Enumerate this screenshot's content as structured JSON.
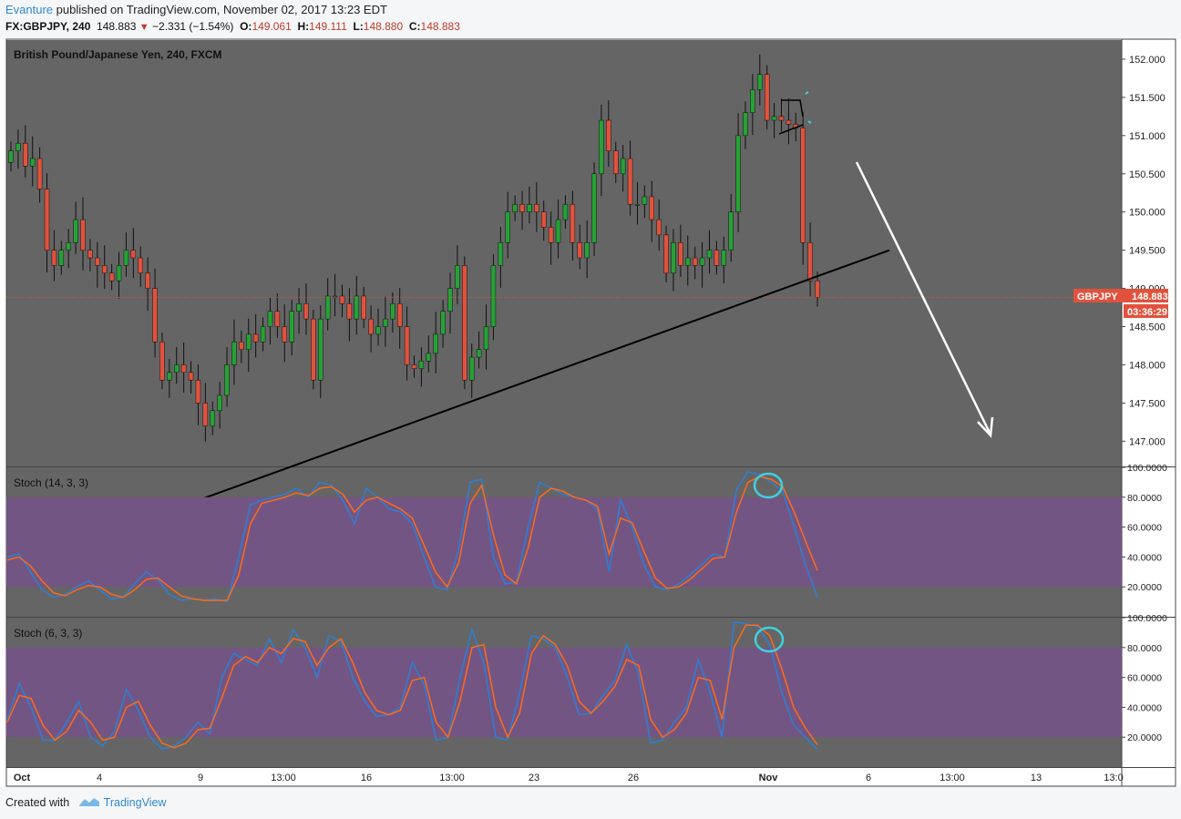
{
  "header": {
    "author": "Evanture",
    "published": "published on TradingView.com, November 02, 2017 13:23 EDT",
    "symbol": "FX:GBPJPY, 240",
    "last": "148.883",
    "change": "−2.331 (−1.54%)",
    "open_label": "O:",
    "open": "149.061",
    "high_label": "H:",
    "high": "149.111",
    "low_label": "L:",
    "low": "148.880",
    "close_label": "C:",
    "close": "148.883"
  },
  "price_pane": {
    "title": "British Pound/Japanese Yen, 240, FXCM",
    "badge_symbol": "GBPJPY",
    "badge_price": "148.883",
    "badge_countdown": "03:36:29"
  },
  "stoch1_title": "Stoch (14, 3, 3)",
  "stoch2_title": "Stoch (6, 3, 3)",
  "footer": {
    "created_with": "Created with",
    "brand": "TradingView"
  },
  "colors": {
    "pane_bg": "#656565",
    "stoch_band": "#735583",
    "up": "#26a136",
    "down": "#e1523d",
    "k_line": "#2d7fd6",
    "d_line": "#ff6a1a",
    "price_line": "#e1523d",
    "badge": "#e1523d",
    "axis_text": "#222222"
  },
  "chart_data": [
    {
      "type": "candlestick",
      "title": "British Pound/Japanese Yen, 240, FXCM",
      "x_ticks": [
        "Oct",
        "4",
        "9",
        "13:00",
        "16",
        "13:00",
        "23",
        "26",
        "Nov",
        "6",
        "13:00",
        "13",
        "13:0"
      ],
      "y_ticks": [
        "152.000",
        "151.500",
        "151.000",
        "150.500",
        "150.000",
        "149.500",
        "149.000",
        "148.500",
        "148.000",
        "147.500",
        "147.000"
      ],
      "ylim": [
        146.67,
        152.25
      ],
      "last_price": 148.883,
      "close_series": [
        150.8,
        150.9,
        150.6,
        150.7,
        150.3,
        149.5,
        149.3,
        149.5,
        149.6,
        149.9,
        149.5,
        149.4,
        149.3,
        149.2,
        149.1,
        149.3,
        149.5,
        149.4,
        149.2,
        149.0,
        148.3,
        147.8,
        147.9,
        148.0,
        147.9,
        147.8,
        147.5,
        147.2,
        147.4,
        147.6,
        148.0,
        148.3,
        148.2,
        148.4,
        148.3,
        148.5,
        148.7,
        148.5,
        148.3,
        148.7,
        148.8,
        148.6,
        147.8,
        148.6,
        148.9,
        148.9,
        148.8,
        148.6,
        148.9,
        148.6,
        148.4,
        148.5,
        148.6,
        148.8,
        148.5,
        148.0,
        147.95,
        148.05,
        148.15,
        148.4,
        148.7,
        149.0,
        149.3,
        147.8,
        148.1,
        148.2,
        148.5,
        149.3,
        149.6,
        150.0,
        150.1,
        150.0,
        150.1,
        150.0,
        149.8,
        149.6,
        149.9,
        150.1,
        149.6,
        149.4,
        149.6,
        150.5,
        151.2,
        150.8,
        150.5,
        150.7,
        150.1,
        150.1,
        150.2,
        149.9,
        149.7,
        149.2,
        149.6,
        149.3,
        149.4,
        149.3,
        149.4,
        149.5,
        149.3,
        149.5,
        150.0,
        151.0,
        151.3,
        151.6,
        151.8,
        151.2,
        151.25,
        151.2,
        151.15,
        151.1,
        149.6,
        149.1,
        148.883
      ],
      "trendline": [
        [
          "13 Oct",
          147.2
        ],
        [
          "4 Nov",
          149.5
        ]
      ],
      "annotations": [
        "triangle pattern near 151.25",
        "arrow pointing down toward 147.0"
      ]
    },
    {
      "type": "line",
      "title": "Stoch (14, 3, 3)",
      "y_ticks": [
        "100.0000",
        "80.0000",
        "60.0000",
        "40.0000",
        "20.0000"
      ],
      "ylim": [
        0,
        100
      ],
      "band": [
        20,
        80
      ],
      "series": [
        {
          "values": [
            40,
            42,
            30,
            18,
            13,
            15,
            20,
            24,
            18,
            12,
            13,
            22,
            30,
            25,
            15,
            11,
            12,
            11,
            12,
            10,
            40,
            75,
            78,
            80,
            82,
            86,
            80,
            90,
            88,
            78,
            62,
            86,
            80,
            72,
            70,
            62,
            40,
            20,
            18,
            45,
            90,
            92,
            40,
            22,
            23,
            60,
            90,
            86,
            82,
            80,
            78,
            72,
            30,
            78,
            60,
            35,
            20,
            18,
            22,
            28,
            35,
            42,
            40,
            85,
            97,
            95,
            90,
            84,
            60,
            34,
            13
          ]
        },
        {
          "values": [
            38,
            40,
            34,
            24,
            16,
            14,
            18,
            21,
            20,
            15,
            13,
            18,
            25,
            26,
            20,
            14,
            12,
            11,
            11,
            11,
            28,
            62,
            76,
            78,
            80,
            83,
            81,
            86,
            87,
            82,
            70,
            78,
            80,
            76,
            72,
            66,
            48,
            30,
            20,
            36,
            76,
            88,
            55,
            28,
            22,
            46,
            80,
            86,
            84,
            80,
            78,
            74,
            42,
            66,
            63,
            44,
            26,
            19,
            20,
            25,
            32,
            39,
            40,
            70,
            90,
            94,
            92,
            87,
            70,
            50,
            31
          ]
        }
      ]
    },
    {
      "type": "line",
      "title": "Stoch (6, 3, 3)",
      "y_ticks": [
        "100.0000",
        "80.0000",
        "60.0000",
        "40.0000",
        "20.0000"
      ],
      "ylim": [
        0,
        100
      ],
      "band": [
        20,
        80
      ],
      "series": [
        {
          "values": [
            32,
            56,
            40,
            18,
            18,
            30,
            44,
            20,
            14,
            24,
            52,
            38,
            20,
            12,
            14,
            20,
            30,
            22,
            60,
            76,
            72,
            68,
            86,
            70,
            92,
            80,
            60,
            88,
            84,
            60,
            44,
            34,
            35,
            40,
            70,
            55,
            18,
            20,
            60,
            92,
            70,
            20,
            18,
            50,
            88,
            86,
            80,
            60,
            35,
            36,
            48,
            58,
            82,
            62,
            16,
            18,
            30,
            40,
            72,
            50,
            20,
            97,
            96,
            94,
            82,
            50,
            28,
            20,
            12
          ]
        },
        {
          "values": [
            30,
            48,
            46,
            28,
            18,
            24,
            38,
            30,
            18,
            20,
            40,
            44,
            28,
            16,
            13,
            16,
            25,
            26,
            46,
            68,
            74,
            70,
            80,
            76,
            86,
            84,
            68,
            80,
            86,
            70,
            50,
            38,
            35,
            38,
            58,
            60,
            30,
            20,
            44,
            80,
            82,
            40,
            20,
            36,
            76,
            88,
            82,
            68,
            44,
            36,
            44,
            54,
            72,
            68,
            32,
            20,
            25,
            36,
            60,
            58,
            32,
            80,
            95,
            95,
            88,
            66,
            40,
            26,
            15
          ]
        }
      ]
    }
  ]
}
